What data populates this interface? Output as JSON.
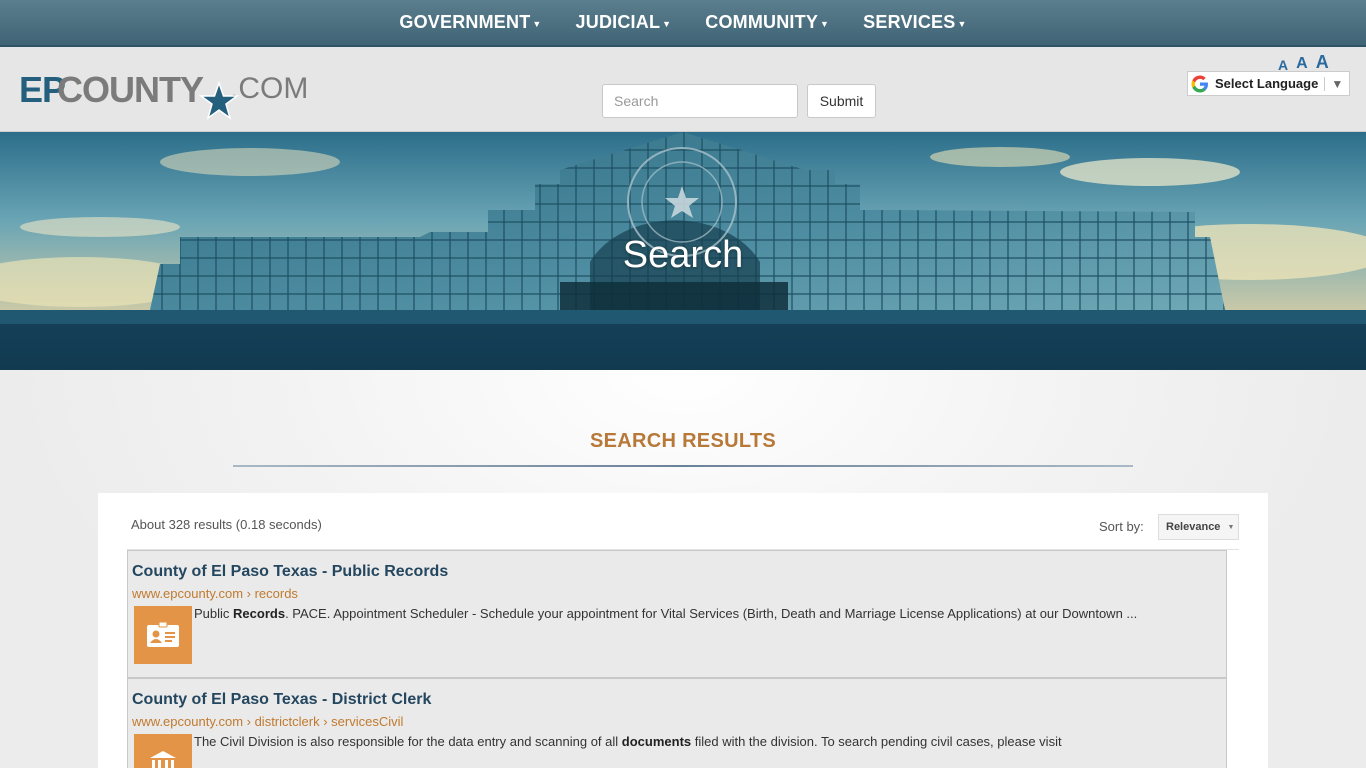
{
  "nav": {
    "items": [
      {
        "label": "GOVERNMENT"
      },
      {
        "label": "JUDICIAL"
      },
      {
        "label": "COMMUNITY"
      },
      {
        "label": "SERVICES"
      }
    ]
  },
  "header": {
    "logo": {
      "ep": "EP",
      "county": "COUNTY",
      "com": ".COM"
    },
    "search": {
      "placeholder": "Search",
      "submit_label": "Submit"
    },
    "font_sizes": [
      "A",
      "A",
      "A"
    ],
    "language": {
      "label": "Select Language",
      "arrow": "▼"
    }
  },
  "hero": {
    "title": "Search"
  },
  "results": {
    "heading": "SEARCH RESULTS",
    "count_text": "About 328 results (0.18 seconds)",
    "sort_label": "Sort by:",
    "sort_value": "Relevance",
    "items": [
      {
        "title": "County of El Paso Texas - Public Records",
        "url": "www.epcounty.com › records",
        "snippet_pre": "Public ",
        "snippet_bold": "Records",
        "snippet_post": ". PACE. Appointment Scheduler - Schedule your appointment for Vital Services (Birth, Death and Marriage License Applications) at our Downtown ...",
        "icon": "id-card-icon"
      },
      {
        "title": "County of El Paso Texas - District Clerk",
        "url": "www.epcounty.com › districtclerk › servicesCivil",
        "snippet_pre": "The Civil Division is also responsible for the data entry and scanning of all ",
        "snippet_bold": "documents",
        "snippet_post": " filed with the division. To search pending civil cases, please visit",
        "icon": "courthouse-icon"
      }
    ]
  },
  "colors": {
    "nav_bg": "#4a6f80",
    "accent": "#b77838",
    "link": "#24475f",
    "url": "#c07a2f"
  }
}
